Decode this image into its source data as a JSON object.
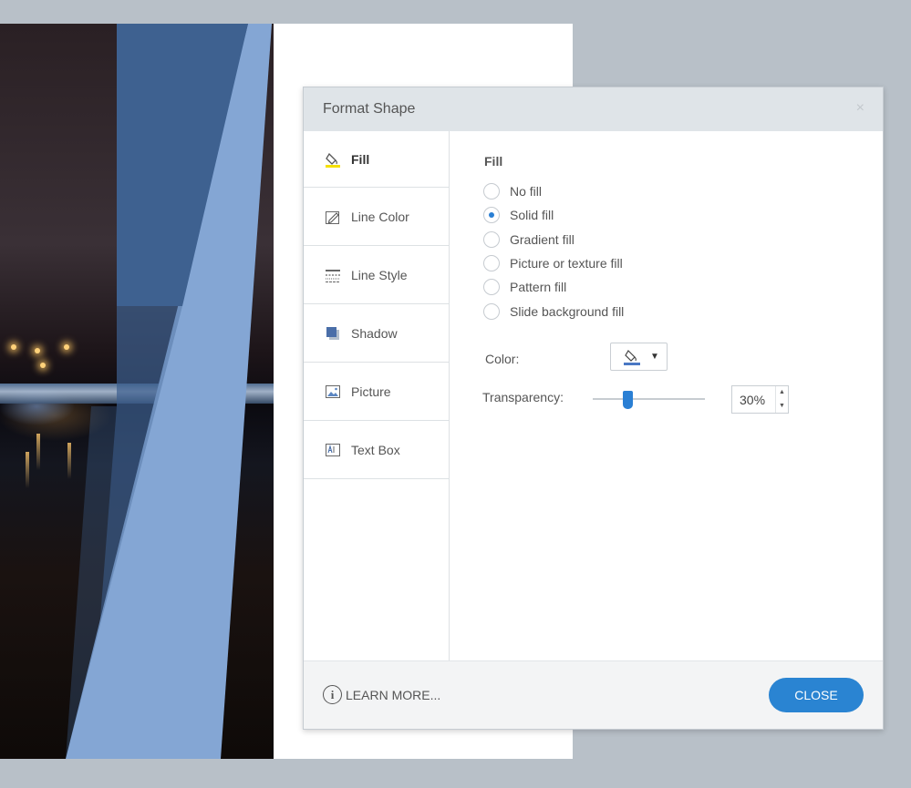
{
  "dialog": {
    "title": "Format Shape",
    "close_glyph": "×"
  },
  "sidebar": {
    "items": [
      {
        "label": "Fill",
        "icon": "paint-bucket-icon",
        "active": true
      },
      {
        "label": "Line Color",
        "icon": "pencil-icon",
        "active": false
      },
      {
        "label": "Line Style",
        "icon": "line-style-icon",
        "active": false
      },
      {
        "label": "Shadow",
        "icon": "shadow-icon",
        "active": false
      },
      {
        "label": "Picture",
        "icon": "picture-icon",
        "active": false
      },
      {
        "label": "Text Box",
        "icon": "text-box-icon",
        "active": false
      }
    ]
  },
  "fill": {
    "section_label": "Fill",
    "options": [
      {
        "label": "No fill",
        "checked": false
      },
      {
        "label": "Solid fill",
        "checked": true
      },
      {
        "label": "Gradient fill",
        "checked": false
      },
      {
        "label": "Picture or texture fill",
        "checked": false
      },
      {
        "label": "Pattern fill",
        "checked": false
      },
      {
        "label": "Slide background fill",
        "checked": false
      }
    ],
    "color_label": "Color:",
    "color_swatch": "#4a78c4",
    "transparency_label": "Transparency:",
    "transparency_value": "30%",
    "transparency_percent": 30
  },
  "footer": {
    "learn_more": "LEARN MORE...",
    "close_label": "CLOSE"
  },
  "colors": {
    "accent": "#2a84d2",
    "shape_light": "#84a6d4",
    "shape_dark": "#3d5f8f",
    "backdrop": "#b8c0c8"
  }
}
